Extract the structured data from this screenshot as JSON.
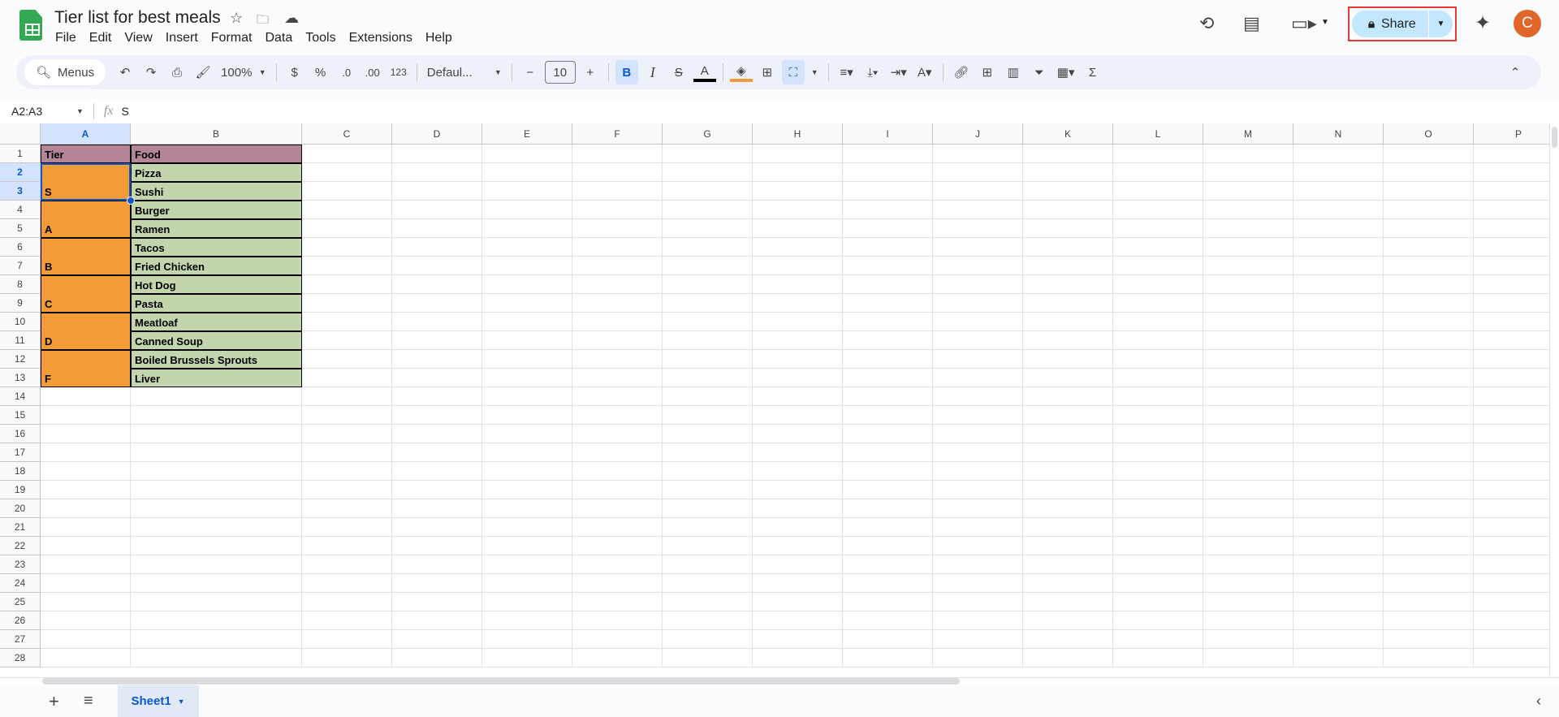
{
  "doc": {
    "title": "Tier list for best meals"
  },
  "menu": [
    "File",
    "Edit",
    "View",
    "Insert",
    "Format",
    "Data",
    "Tools",
    "Extensions",
    "Help"
  ],
  "toolbar": {
    "search": "Menus",
    "zoom": "100%",
    "currency": "$",
    "percent": "%",
    "dec_dec": ".0",
    "dec_inc": ".00",
    "number_format": "123",
    "font": "Defaul...",
    "font_size": "10",
    "bold": "B",
    "italic": "I",
    "text_color": "A",
    "sum": "Σ"
  },
  "header": {
    "share": "Share",
    "avatar": "C"
  },
  "formula": {
    "name_box": "A2:A3",
    "fx": "fx",
    "value": "S"
  },
  "columns": [
    "A",
    "B",
    "C",
    "D",
    "E",
    "F",
    "G",
    "H",
    "I",
    "J",
    "K",
    "L",
    "M",
    "N",
    "O",
    "P"
  ],
  "row_count": 28,
  "selected": {
    "col": "A",
    "rows": [
      2,
      3
    ]
  },
  "colors": {
    "header_fill": "#b4849b",
    "tier_fill": "#f39b37",
    "food_fill": "#c3d5ad",
    "accent": "#0b57d0"
  },
  "table": {
    "headers": [
      "Tier",
      "Food"
    ],
    "tiers": [
      {
        "label": "S",
        "foods": [
          "Pizza",
          "Sushi"
        ]
      },
      {
        "label": "A",
        "foods": [
          "Burger",
          "Ramen"
        ]
      },
      {
        "label": "B",
        "foods": [
          "Tacos",
          "Fried Chicken"
        ]
      },
      {
        "label": "C",
        "foods": [
          "Hot Dog",
          "Pasta"
        ]
      },
      {
        "label": "D",
        "foods": [
          "Meatloaf",
          "Canned Soup"
        ]
      },
      {
        "label": "F",
        "foods": [
          "Boiled Brussels Sprouts",
          "Liver"
        ]
      }
    ]
  },
  "sheets": [
    {
      "name": "Sheet1",
      "active": true
    }
  ]
}
